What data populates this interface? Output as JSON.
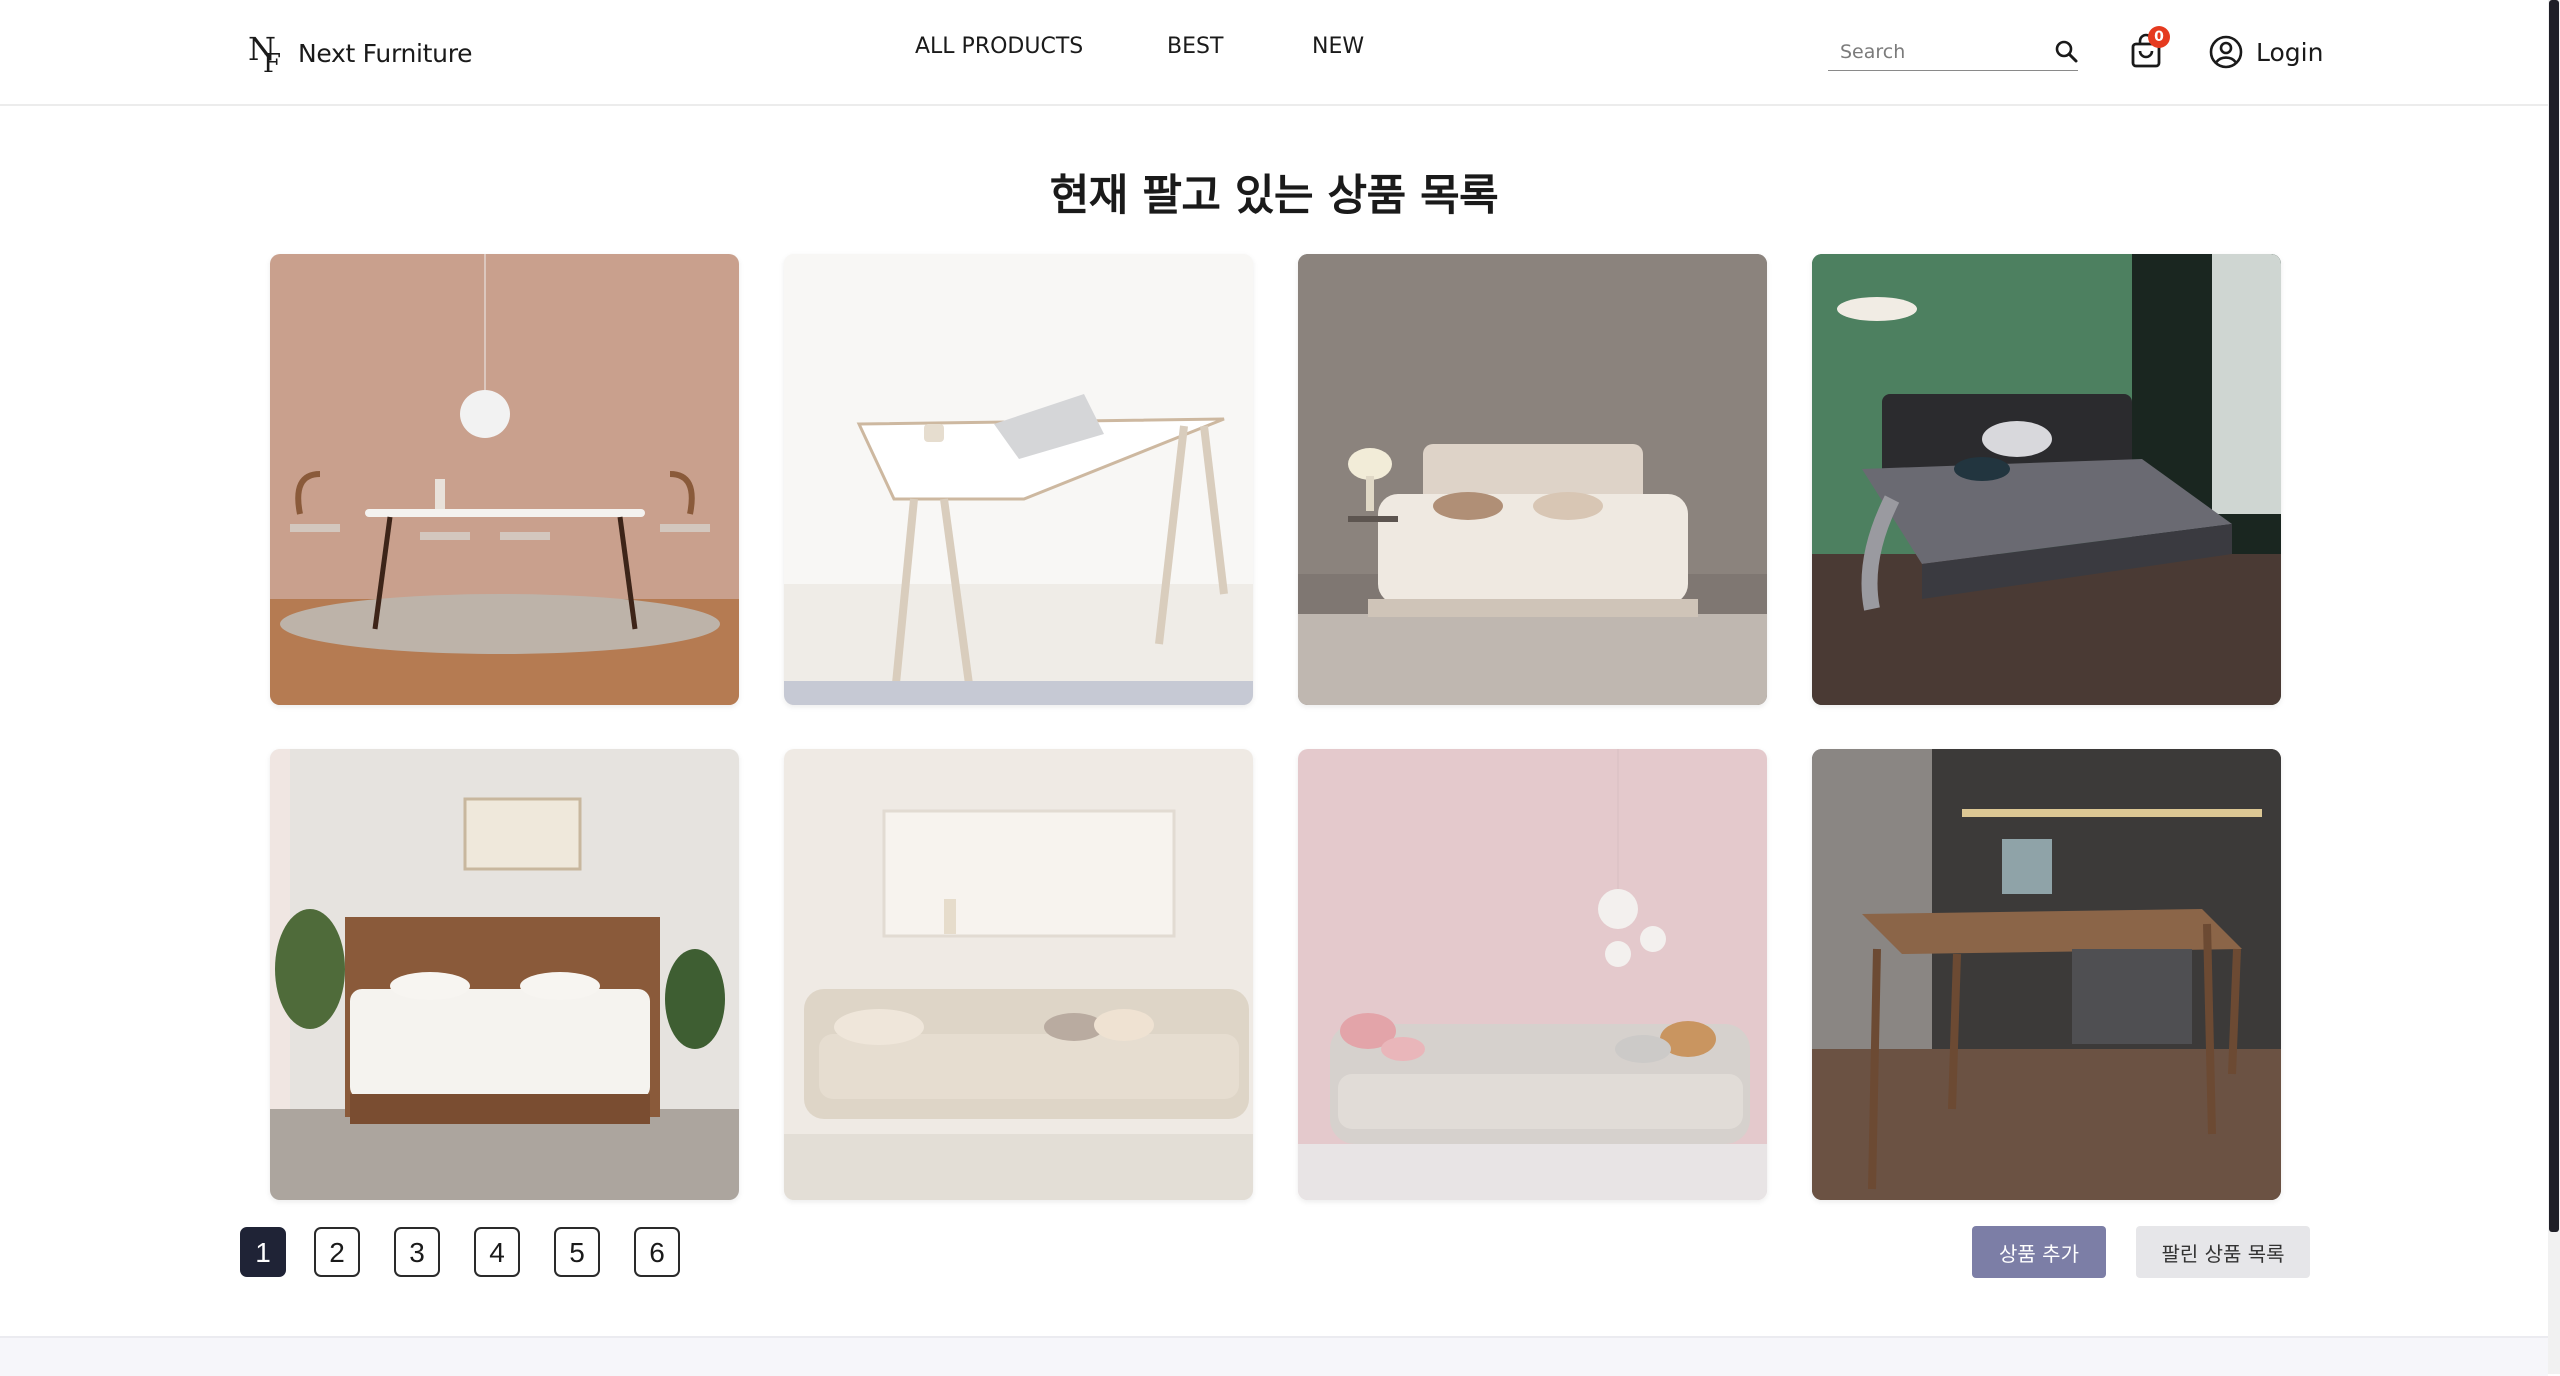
{
  "header": {
    "logo_text": "Next Furniture",
    "nav": [
      "ALL PRODUCTS",
      "BEST",
      "NEW"
    ],
    "search_placeholder": "Search",
    "cart_count": "0",
    "login_label": "Login"
  },
  "main": {
    "title": "현재 팔고 있는 상품 목록"
  },
  "pagination": {
    "pages": [
      "1",
      "2",
      "3",
      "4",
      "5",
      "6"
    ],
    "active_page": "1"
  },
  "actions": {
    "add_label": "상품 추가",
    "sold_label": "팔린 상품 목록"
  },
  "colors": {
    "accent": "#7c7ea6",
    "active_page": "#1f2336",
    "cart_badge": "#e53a1f"
  }
}
